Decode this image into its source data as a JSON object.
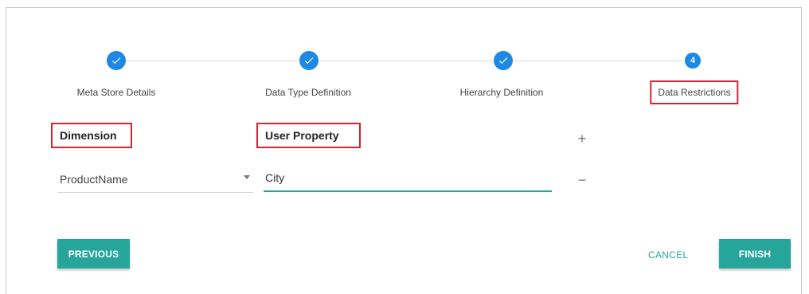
{
  "stepper": {
    "steps": [
      {
        "label": "Meta Store Details",
        "state": "completed",
        "icon": "check-icon"
      },
      {
        "label": "Data Type Definition",
        "state": "completed",
        "icon": "check-icon"
      },
      {
        "label": "Hierarchy Definition",
        "state": "completed",
        "icon": "check-icon"
      },
      {
        "label": "Data Restrictions",
        "state": "active",
        "number": "4"
      }
    ],
    "accent_color": "#1e88e5"
  },
  "form": {
    "dimension_header": "Dimension",
    "user_property_header": "User Property",
    "add_icon": "+",
    "remove_icon": "−",
    "dimension_value": "ProductName",
    "user_property_value": "City"
  },
  "actions": {
    "previous_label": "PREVIOUS",
    "cancel_label": "CANCEL",
    "finish_label": "FINISH"
  },
  "colors": {
    "primary": "#26a69a",
    "highlight_border": "#d0262f"
  }
}
